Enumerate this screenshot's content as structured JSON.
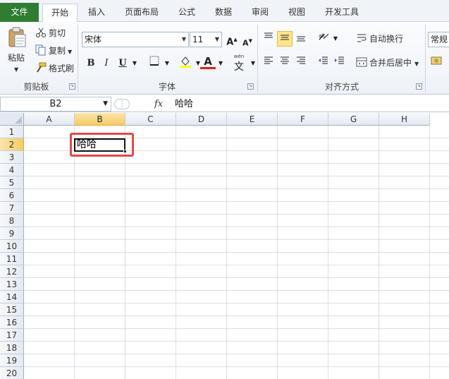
{
  "tabs": [
    "文件",
    "开始",
    "插入",
    "页面布局",
    "公式",
    "数据",
    "审阅",
    "视图",
    "开发工具"
  ],
  "active_tab": "开始",
  "clipboard": {
    "paste_label": "粘贴",
    "cut_label": "剪切",
    "copy_label": "复制",
    "format_painter_label": "格式刷",
    "group_label": "剪贴板"
  },
  "font": {
    "font_name": "宋体",
    "font_size": "11",
    "grow_label": "A",
    "shrink_label": "A",
    "bold_label": "B",
    "italic_label": "I",
    "underline_label": "U",
    "font_color_label": "A",
    "phonetic_label": "文",
    "group_label": "字体",
    "fill_color": "#ffff00",
    "font_color": "#e02020"
  },
  "alignment": {
    "wrap_label": "自动换行",
    "merge_label": "合并后居中",
    "group_label": "对齐方式"
  },
  "number": {
    "format_label": "常规"
  },
  "formula_bar": {
    "name_box": "B2",
    "fx": "fx",
    "value": "哈哈"
  },
  "columns": [
    "A",
    "B",
    "C",
    "D",
    "E",
    "F",
    "G",
    "H"
  ],
  "active_column": "B",
  "rows": [
    "1",
    "2",
    "3",
    "4",
    "5",
    "6",
    "7",
    "8",
    "9",
    "10",
    "11",
    "12",
    "13",
    "14",
    "15",
    "16",
    "17",
    "18",
    "19",
    "20"
  ],
  "active_row": "2",
  "cell_b2": "哈哈",
  "colors": {
    "file_tab": "#2e7d32",
    "highlight_box": "#e04a4a",
    "active_header": "#f5cb66"
  }
}
